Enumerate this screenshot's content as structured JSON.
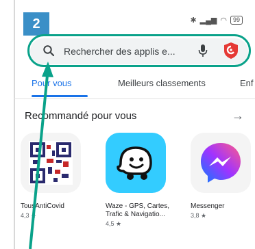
{
  "annotation": {
    "step_number": "2"
  },
  "status_bar": {
    "left_icon": "settings-icon",
    "battery_text": "99",
    "icons": [
      "bluetooth-icon",
      "signal-icon",
      "wifi-icon",
      "battery-icon"
    ]
  },
  "search": {
    "placeholder": "Rechercher des applis e...",
    "icons": [
      "search-icon",
      "mic-icon",
      "account-icon"
    ]
  },
  "tabs": [
    {
      "label": "Pour vous"
    },
    {
      "label": "Meilleurs classements"
    },
    {
      "label": "Enf"
    }
  ],
  "section": {
    "title": "Recommandé pour vous",
    "arrow": "→"
  },
  "apps": [
    {
      "name": "TousAntiCovid",
      "rating": "4,3 ★"
    },
    {
      "name": "Waze - GPS, Cartes, Trafic & Navigatio...",
      "rating": "4,5 ★"
    },
    {
      "name": "Messenger",
      "rating": "3,8 ★"
    }
  ],
  "colors": {
    "annotation_teal": "#0aa28a",
    "badge_blue": "#3a8fc7",
    "accent_blue": "#1a73e8"
  }
}
